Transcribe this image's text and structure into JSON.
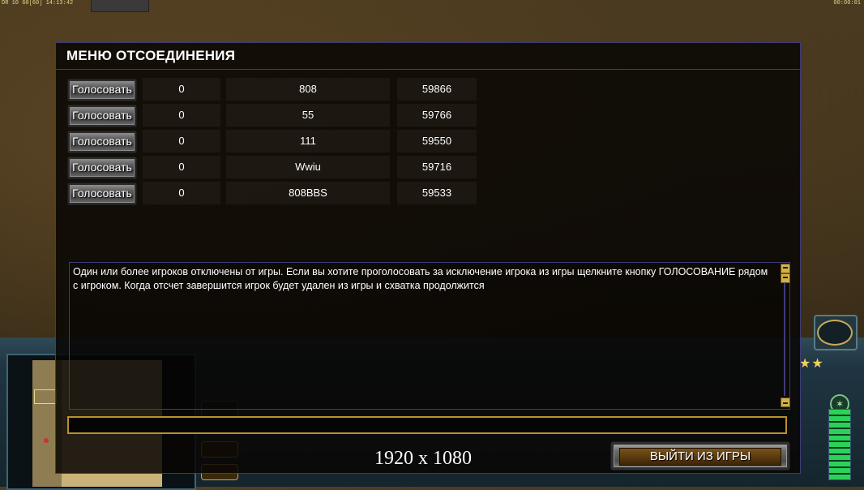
{
  "hud": {
    "fps": "DR 10 60[60] 14:13:42",
    "clock": "00:00:01"
  },
  "menu": {
    "title": "МЕНЮ ОТСОЕДИНЕНИЯ",
    "vote_label": "Голосовать",
    "players": [
      {
        "votes": "0",
        "name": "808",
        "ping": "59866"
      },
      {
        "votes": "0",
        "name": "55",
        "ping": "59766"
      },
      {
        "votes": "0",
        "name": "111",
        "ping": "59550"
      },
      {
        "votes": "0",
        "name": "Wwiu",
        "ping": "59716"
      },
      {
        "votes": "0",
        "name": "808BBS",
        "ping": "59533"
      }
    ],
    "info_text": "Один или более игроков отключены от игры. Если вы хотите проголосовать за исключение игрока из игры щелкните кнопку  ГОЛОСОВАНИЕ рядом с игроком. Когда отсчет завершится игрок будет удален из игры и схватка продолжится",
    "chat_value": "",
    "quit_label": "ВЫЙТИ ИЗ ИГРЫ"
  },
  "overlay": {
    "resolution": "1920 x 1080"
  },
  "colors": {
    "menu_border": "#3e3b7a",
    "input_border": "#b8902c",
    "quit_inner": "#7a5218"
  },
  "icons": [
    "scroll-up-icon",
    "scroll-down-icon",
    "radar-icon",
    "rank-star-icon",
    "rank-emblem-icon"
  ]
}
